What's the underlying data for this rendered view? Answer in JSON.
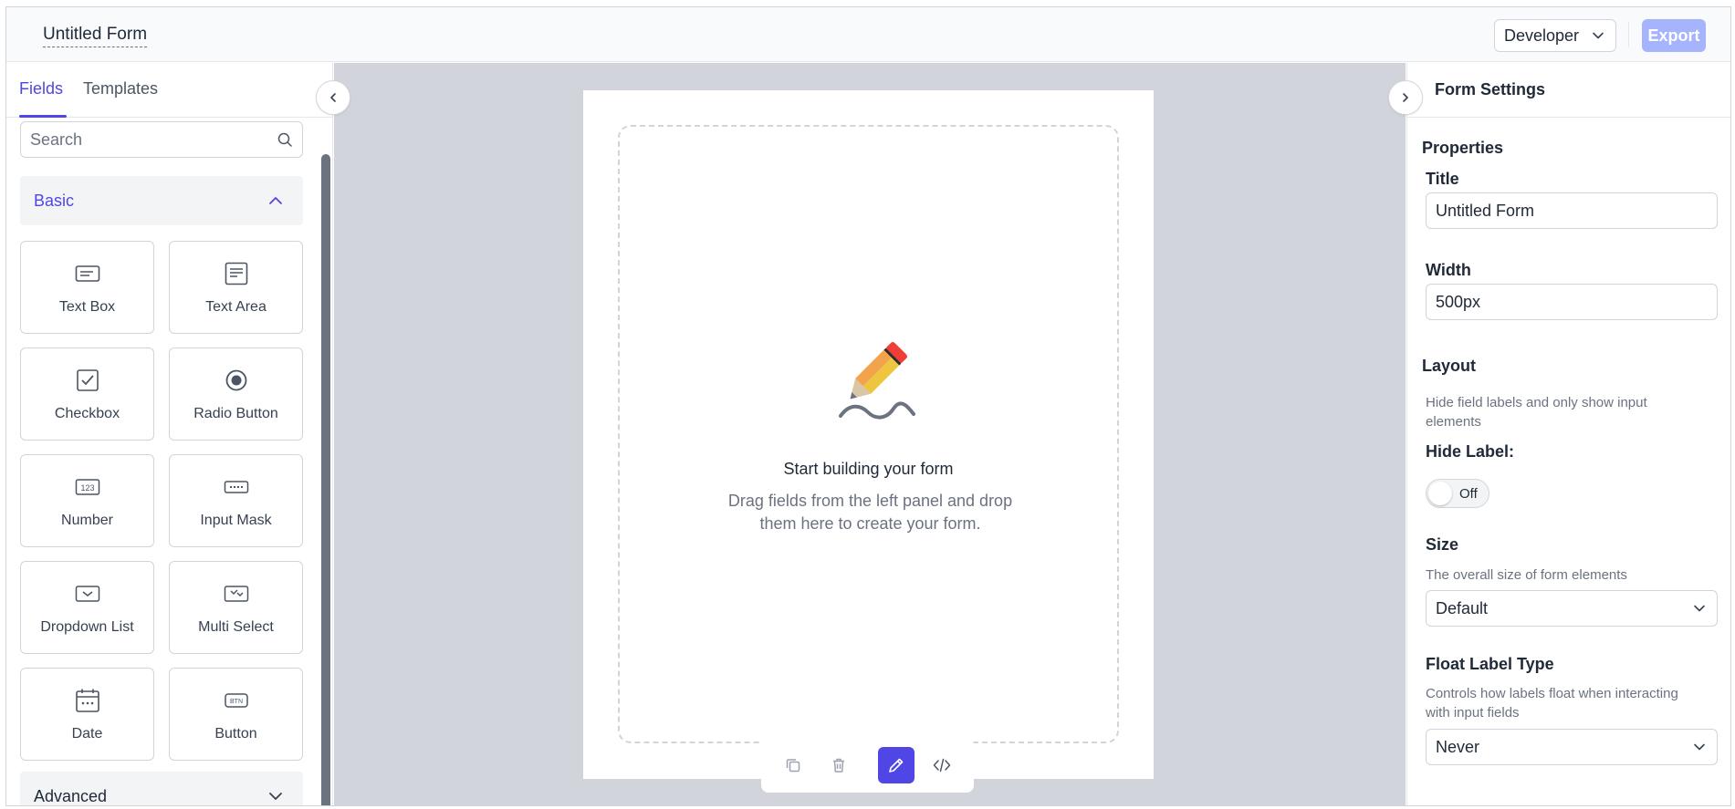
{
  "header": {
    "form_title": "Untitled Form",
    "mode": "Developer",
    "export_label": "Export"
  },
  "left_panel": {
    "tabs": [
      {
        "label": "Fields",
        "active": true
      },
      {
        "label": "Templates",
        "active": false
      }
    ],
    "search_placeholder": "Search",
    "basic_section": "Basic",
    "advanced_section": "Advanced",
    "fields": [
      {
        "label": "Text Box",
        "icon": "text-box-icon"
      },
      {
        "label": "Text Area",
        "icon": "text-area-icon"
      },
      {
        "label": "Checkbox",
        "icon": "checkbox-icon"
      },
      {
        "label": "Radio Button",
        "icon": "radio-button-icon"
      },
      {
        "label": "Number",
        "icon": "number-icon"
      },
      {
        "label": "Input Mask",
        "icon": "input-mask-icon"
      },
      {
        "label": "Dropdown List",
        "icon": "dropdown-list-icon"
      },
      {
        "label": "Multi Select",
        "icon": "multi-select-icon"
      },
      {
        "label": "Date",
        "icon": "date-icon"
      },
      {
        "label": "Button",
        "icon": "button-icon"
      }
    ]
  },
  "canvas": {
    "empty_title": "Start building your form",
    "empty_desc": "Drag fields from the left panel and drop them here to create your form.",
    "toolbar": [
      "copy-icon",
      "trash-icon",
      "pencil-icon",
      "code-icon"
    ]
  },
  "right_panel": {
    "title": "Form Settings",
    "properties_heading": "Properties",
    "title_label": "Title",
    "title_value": "Untitled Form",
    "width_label": "Width",
    "width_value": "500px",
    "layout_heading": "Layout",
    "layout_help": "Hide field labels and only show input elements",
    "hide_label_label": "Hide Label:",
    "hide_label_state": "Off",
    "size_label": "Size",
    "size_help": "The overall size of form elements",
    "size_value": "Default",
    "float_label_label": "Float Label Type",
    "float_label_help": "Controls how labels float when interacting with input fields",
    "float_label_value": "Never"
  },
  "colors": {
    "accent": "#4f46e5",
    "export_disabled": "#a5b4fc",
    "canvas_bg": "#d1d5db"
  }
}
